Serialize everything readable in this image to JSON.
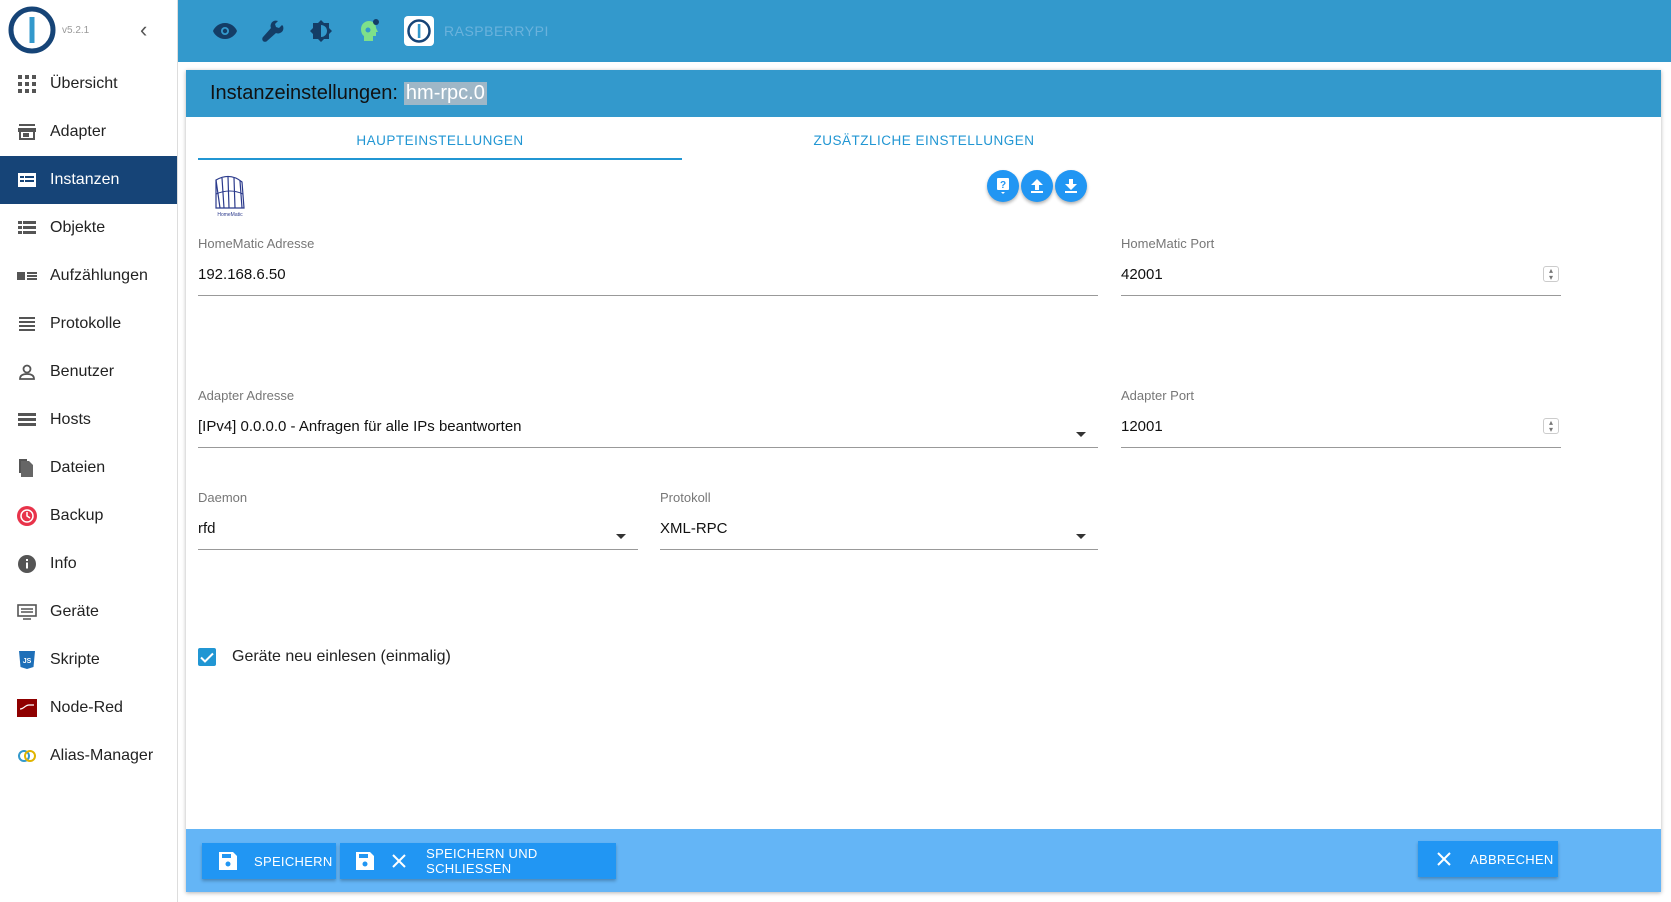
{
  "app": {
    "version": "v5.2.1",
    "host_name": "RASPBERRYPI"
  },
  "sidebar": {
    "items": [
      {
        "label": "Übersicht",
        "icon": "grid-icon"
      },
      {
        "label": "Adapter",
        "icon": "store-icon"
      },
      {
        "label": "Instanzen",
        "icon": "instances-icon",
        "active": true
      },
      {
        "label": "Objekte",
        "icon": "list-icon"
      },
      {
        "label": "Aufzählungen",
        "icon": "enum-icon"
      },
      {
        "label": "Protokolle",
        "icon": "lines-icon"
      },
      {
        "label": "Benutzer",
        "icon": "person-icon"
      },
      {
        "label": "Hosts",
        "icon": "storage-icon"
      },
      {
        "label": "Dateien",
        "icon": "files-icon"
      },
      {
        "label": "Backup",
        "icon": "backup-icon"
      },
      {
        "label": "Info",
        "icon": "info-icon"
      },
      {
        "label": "Geräte",
        "icon": "devices-icon"
      },
      {
        "label": "Skripte",
        "icon": "javascript-icon"
      },
      {
        "label": "Node-Red",
        "icon": "node-red-icon"
      },
      {
        "label": "Alias-Manager",
        "icon": "alias-icon"
      }
    ]
  },
  "dialog": {
    "title_prefix": "Instanzeinstellungen:",
    "instance": "hm-rpc.0",
    "tabs": [
      {
        "label": "HAUPTEINSTELLUNGEN",
        "active": true
      },
      {
        "label": "ZUSÄTZLICHE EINSTELLUNGEN",
        "active": false
      }
    ],
    "fields": {
      "homematic_address": {
        "label": "HomeMatic Adresse",
        "value": "192.168.6.50"
      },
      "homematic_port": {
        "label": "HomeMatic Port",
        "value": "42001"
      },
      "adapter_address": {
        "label": "Adapter Adresse",
        "value": "[IPv4] 0.0.0.0 - Anfragen für alle IPs beantworten"
      },
      "adapter_port": {
        "label": "Adapter Port",
        "value": "12001"
      },
      "daemon": {
        "label": "Daemon",
        "value": "rfd"
      },
      "protocol": {
        "label": "Protokoll",
        "value": "XML-RPC"
      }
    },
    "checkbox": {
      "label": "Geräte neu einlesen (einmalig)",
      "checked": true
    },
    "adapter_logo_text": "HomeMatic"
  },
  "footer": {
    "save": "SPEICHERN",
    "save_close": "SPEICHERN UND SCHLIESSEN",
    "cancel": "ABBRECHEN"
  },
  "colors": {
    "topbar": "#3399cc",
    "active_nav": "#164477",
    "accent": "#2196f3",
    "footer": "#64b5f6"
  }
}
